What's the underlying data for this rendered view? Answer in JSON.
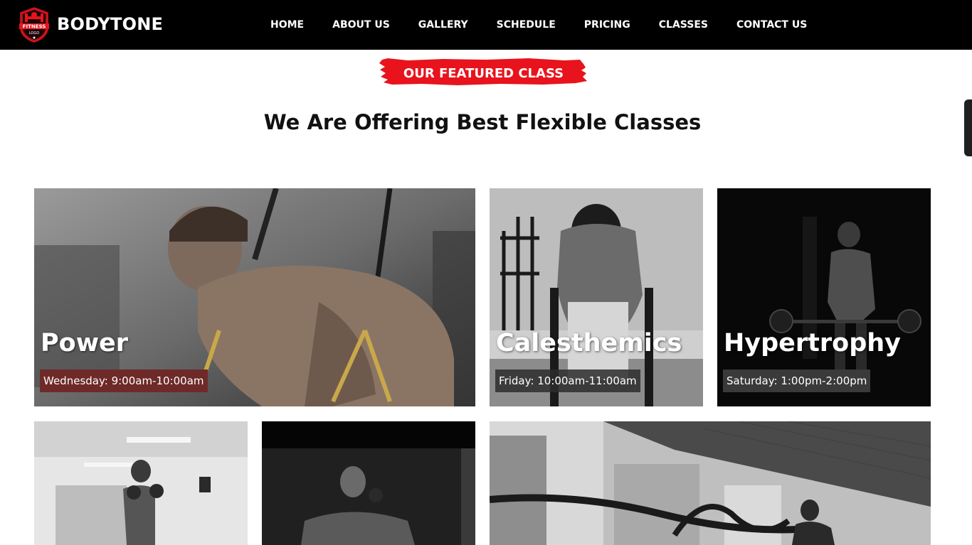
{
  "brand": {
    "logo_icon": "fitness-logo-icon",
    "logo_text": "FITNESS",
    "logo_subtext": "LOGO",
    "name": "BODYTONE"
  },
  "nav": {
    "items": [
      {
        "label": "HOME"
      },
      {
        "label": "ABOUT US"
      },
      {
        "label": "GALLERY"
      },
      {
        "label": "SCHEDULE"
      },
      {
        "label": "PRICING"
      },
      {
        "label": "CLASSES"
      },
      {
        "label": "CONTACT US"
      }
    ]
  },
  "section": {
    "eyebrow": "OUR FEATURED CLASS",
    "title": "We Are Offering Best Flexible Classes"
  },
  "colors": {
    "accent_red": "#e8131c",
    "header_bg": "#000000",
    "power_badge": "#6e2a28",
    "dark_badge": "#3a3a3a"
  },
  "classes": [
    {
      "title": "Power",
      "schedule": "Wednesday: 9:00am-10:00am"
    },
    {
      "title": "Calesthemics",
      "schedule": "Friday: 10:00am-11:00am"
    },
    {
      "title": "Hypertrophy",
      "schedule": "Saturday: 1:00pm-2:00pm"
    },
    {
      "title": "",
      "schedule": ""
    },
    {
      "title": "",
      "schedule": ""
    },
    {
      "title": "",
      "schedule": ""
    }
  ]
}
